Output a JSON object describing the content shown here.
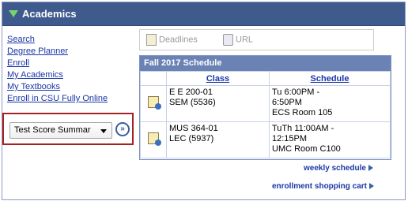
{
  "header": {
    "title": "Academics"
  },
  "links": [
    "Search",
    "Degree Planner",
    "Enroll",
    "My Academics",
    "My Textbooks",
    "Enroll in CSU Fully Online"
  ],
  "selector": {
    "value": "Test Score Summar",
    "go_label": "»"
  },
  "toolbar": {
    "deadlines": "Deadlines",
    "url": "URL"
  },
  "schedule": {
    "title": "Fall 2017 Schedule",
    "columns": [
      "Class",
      "Schedule"
    ],
    "rows": [
      {
        "class_line1": "E E 200-01",
        "class_line2": "SEM (5536)",
        "sched_line1": "Tu 6:00PM -",
        "sched_line2": "6:50PM",
        "sched_line3": "ECS  Room 105"
      },
      {
        "class_line1": "MUS 364-01",
        "class_line2": "LEC (5937)",
        "sched_line1": "TuTh 11:00AM -",
        "sched_line2": "12:15PM",
        "sched_line3": "UMC  Room C100"
      }
    ]
  },
  "footer": {
    "weekly": "weekly schedule",
    "cart": "enrollment shopping cart"
  },
  "colors": {
    "header_bg": "#3f5b8d",
    "link": "#1a37a6",
    "highlight_border": "#a52222",
    "table_header": "#6b82b5"
  }
}
